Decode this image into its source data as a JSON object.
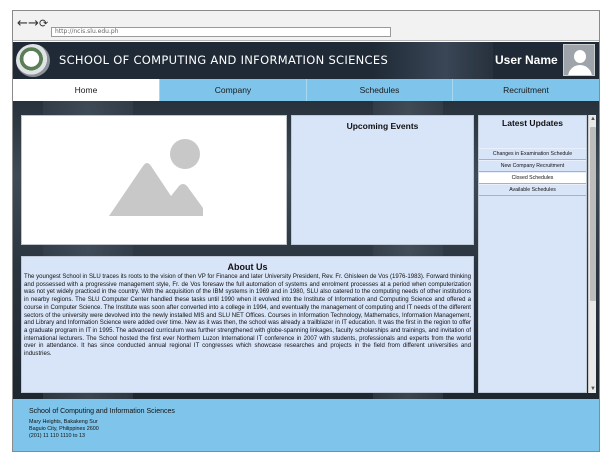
{
  "browser": {
    "back": "←",
    "forward": "→",
    "reload": "⟳",
    "url": "http://ncis.slu.edu.ph"
  },
  "header": {
    "title": "School of Computing and Information Sciences",
    "user_name": "User Name"
  },
  "nav": {
    "tabs": [
      {
        "label": "Home",
        "active": true
      },
      {
        "label": "Company",
        "active": false
      },
      {
        "label": "Schedules",
        "active": false
      },
      {
        "label": "Recruitment",
        "active": false
      }
    ]
  },
  "events": {
    "title": "Upcoming Events"
  },
  "updates": {
    "title": "Latest Updates",
    "items": [
      {
        "label": "Changes in Examination Schedule",
        "selected": false
      },
      {
        "label": "New Company Recruitment",
        "selected": false
      },
      {
        "label": "Closed Schedules",
        "selected": true
      },
      {
        "label": "Available Schedules",
        "selected": false
      }
    ]
  },
  "about": {
    "title": "About Us",
    "body": "The youngest School in SLU traces its roots to the vision of then VP for Finance and later University President, Rev. Fr. Ghisleen de Vos (1976-1983). Forward thinking and possessed with a progressive management style, Fr. de Vos foresaw the full automation of systems and enrolment processes at a period when computerization was not yet widely practiced in the country. With the acquisition of the IBM systems in 1969 and in 1980, SLU also catered to the computing needs of other institutions in nearby regions. The SLU Computer Center handled these tasks until 1990 when it evolved into the Institute of Information and Computing Science and offered a course in Computer Science. The Institute was soon after converted into a college in 1994, and eventually the management of computing and IT needs of the different sectors of the university were devolved into the newly installed MIS and SLU NET Offices. Courses in Information Technology, Mathematics, Information Management, and Library and Information Science were added over time. New as it was then, the school was already a trailblazer in IT education. It was the first in the region to offer a graduate program in IT in 1995. The advanced curriculum was further strengthened with globe-spanning linkages, faculty scholarships and trainings, and invitation of international lecturers. The School hosted the first ever Northern Luzon International IT conference in 2007 with students, professionals and experts from the world over in attendance. It has since conducted annual regional IT congresses which showcase researches and projects in the field from different universities and industries."
  },
  "footer": {
    "title": "School of Computing and Information Sciences",
    "address1": "Mary Heights, Bakakeng Sur",
    "address2": "Baguio City, Philippines 2600",
    "phone": "(201) 11 110 1110 to 13"
  },
  "colors": {
    "accent": "#7fc4ea",
    "panel": "#d8e4f8",
    "header_bg": "#1f2a36"
  }
}
